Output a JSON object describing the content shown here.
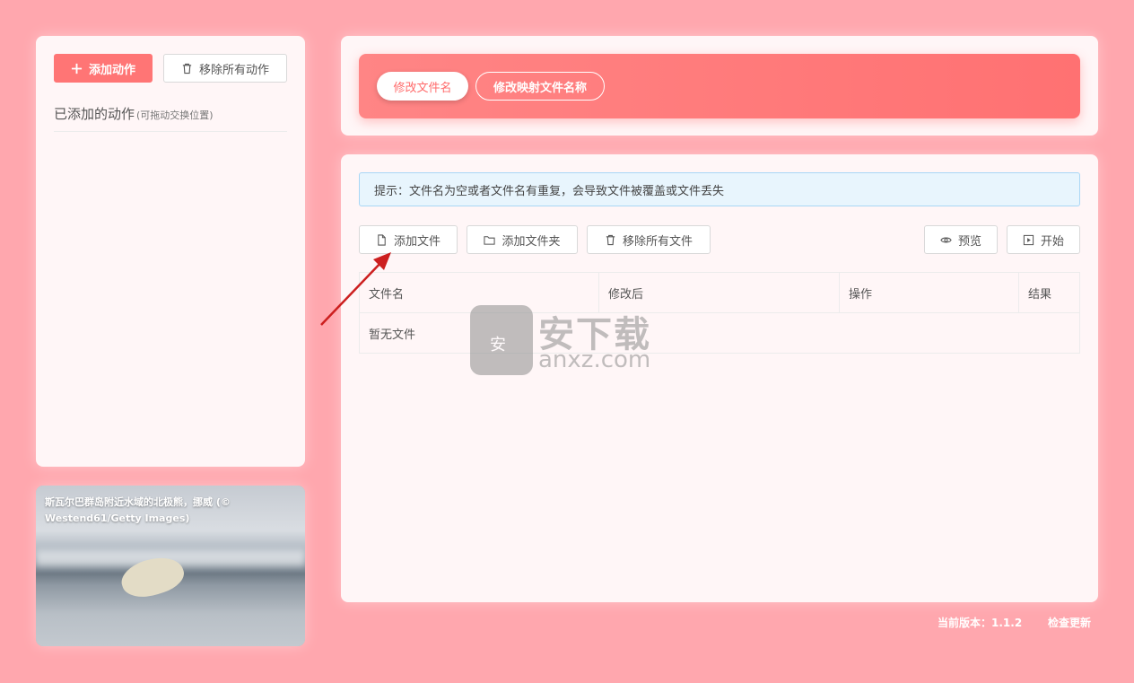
{
  "left_panel": {
    "add_action_label": "添加动作",
    "remove_all_actions_label": "移除所有动作",
    "added_actions_title": "已添加的动作",
    "added_actions_hint": "(可拖动交换位置)"
  },
  "photo": {
    "caption": "斯瓦尔巴群岛附近水域的北极熊，挪威 (© Westend61/Getty Images)"
  },
  "mode_tabs": {
    "rename_label": "修改文件名",
    "mapping_label": "修改映射文件名称"
  },
  "tip": "提示：文件名为空或者文件名有重复，会导致文件被覆盖或文件丢失",
  "toolbar": {
    "add_file_label": "添加文件",
    "add_folder_label": "添加文件夹",
    "remove_all_files_label": "移除所有文件",
    "preview_label": "预览",
    "start_label": "开始"
  },
  "table": {
    "columns": [
      "文件名",
      "修改后",
      "操作",
      "结果"
    ],
    "empty_text": "暂无文件"
  },
  "footer": {
    "version_label": "当前版本：1.1.2",
    "check_update_label": "检查更新"
  },
  "watermark": {
    "shield_text": "安",
    "text": "安下载",
    "domain": "anxz.com"
  },
  "colors": {
    "background": "#ffa7ae",
    "accent": "#ff7575",
    "tip_background": "#e8f5fd"
  }
}
